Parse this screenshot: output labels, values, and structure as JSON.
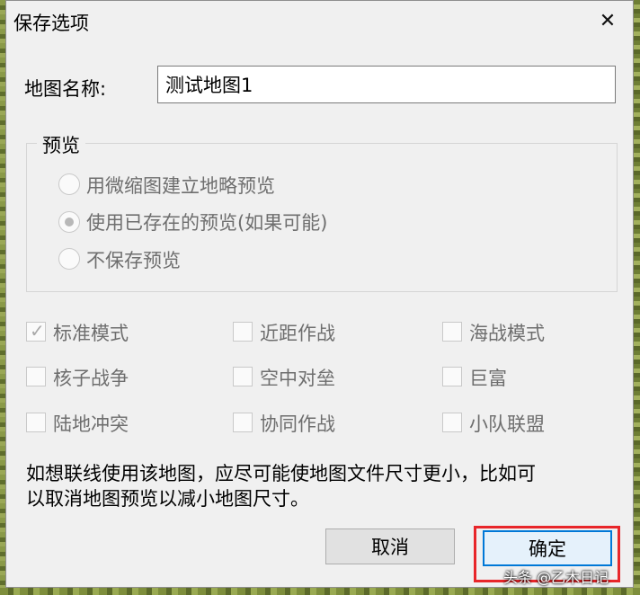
{
  "dialog": {
    "title": "保存选项",
    "close_glyph": "✕"
  },
  "map_name": {
    "label": "地图名称:",
    "value": "测试地图1"
  },
  "preview": {
    "legend": "预览",
    "options": [
      {
        "label": "用微缩图建立地略预览",
        "checked": false
      },
      {
        "label": "使用已存在的预览(如果可能)",
        "checked": true
      },
      {
        "label": "不保存预览",
        "checked": false
      }
    ]
  },
  "modes": [
    {
      "label": "标准模式",
      "checked": true
    },
    {
      "label": "近距作战",
      "checked": false
    },
    {
      "label": "海战模式",
      "checked": false
    },
    {
      "label": "核子战争",
      "checked": false
    },
    {
      "label": "空中对垒",
      "checked": false
    },
    {
      "label": "巨富",
      "checked": false
    },
    {
      "label": "陆地冲突",
      "checked": false
    },
    {
      "label": "协同作战",
      "checked": false
    },
    {
      "label": "小队联盟",
      "checked": false
    }
  ],
  "note": {
    "line1": "如想联线使用该地图，应尽可能使地图文件尺寸更小，比如可",
    "line2": "以取消地图预览以减小地图尺寸。"
  },
  "buttons": {
    "cancel": "取消",
    "ok": "确定"
  },
  "watermark": "头条 @乙木日记",
  "colors": {
    "highlight": "#e8262a",
    "focus": "#0078d7",
    "disabled_text": "#6e6e6e"
  }
}
